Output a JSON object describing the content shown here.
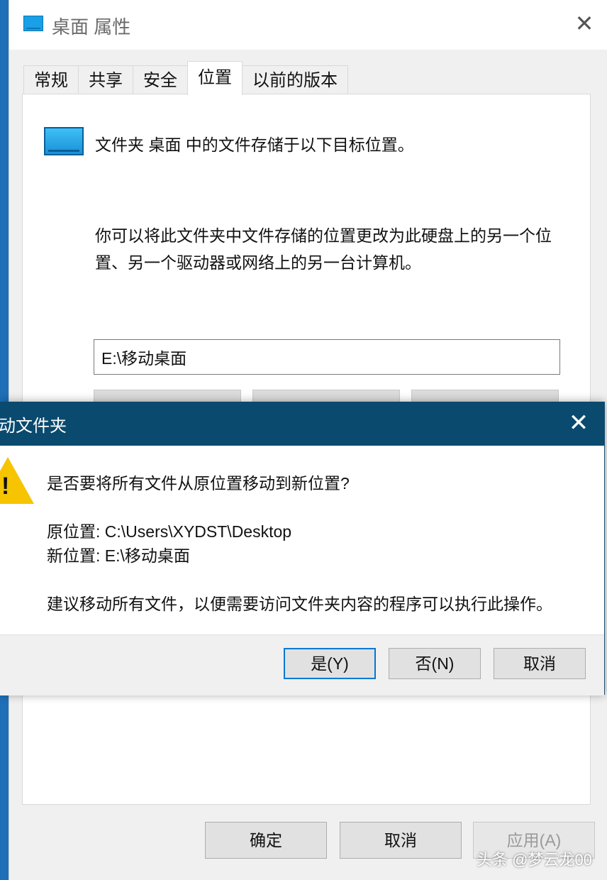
{
  "properties_window": {
    "title": "桌面 属性",
    "close_glyph": "✕",
    "tabs": [
      {
        "label": "常规"
      },
      {
        "label": "共享"
      },
      {
        "label": "安全"
      },
      {
        "label": "位置",
        "active": true
      },
      {
        "label": "以前的版本"
      }
    ],
    "location_tab": {
      "heading": "文件夹 桌面 中的文件存储于以下目标位置。",
      "description": "你可以将此文件夹中文件存储的位置更改为此硬盘上的另一个位置、另一个驱动器或网络上的另一台计算机。",
      "path_value": "E:\\移动桌面"
    },
    "footer_buttons": {
      "ok": "确定",
      "cancel": "取消",
      "apply": "应用(A)"
    }
  },
  "move_folder_dialog": {
    "title": "移动文件夹",
    "close_glyph": "✕",
    "question": "是否要将所有文件从原位置移动到新位置?",
    "original_location": "原位置: C:\\Users\\XYDST\\Desktop",
    "new_location": "新位置: E:\\移动桌面",
    "recommendation": "建议移动所有文件，以便需要访问文件夹内容的程序可以执行此操作。",
    "buttons": {
      "yes": "是(Y)",
      "no": "否(N)",
      "cancel": "取消"
    }
  },
  "icons": {
    "title_icon": "desktop-folder-icon",
    "warning": "warning-icon"
  },
  "colors": {
    "dialog_titlebar": "#0a4a6e",
    "default_button_border": "#0078d7",
    "warning_yellow": "#f6c400"
  },
  "watermark": "头条 @梦云龙00"
}
